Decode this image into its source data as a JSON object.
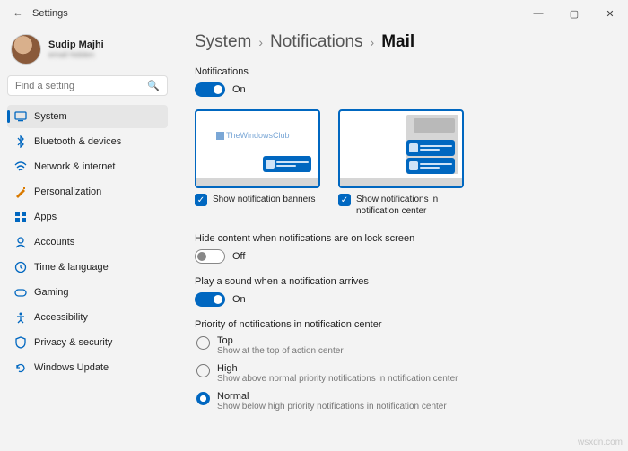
{
  "titlebar": {
    "title": "Settings"
  },
  "user": {
    "name": "Sudip Majhi",
    "email": "email hidden"
  },
  "search": {
    "placeholder": "Find a setting"
  },
  "sidebar": {
    "items": [
      {
        "label": "System",
        "active": true
      },
      {
        "label": "Bluetooth & devices"
      },
      {
        "label": "Network & internet"
      },
      {
        "label": "Personalization"
      },
      {
        "label": "Apps"
      },
      {
        "label": "Accounts"
      },
      {
        "label": "Time & language"
      },
      {
        "label": "Gaming"
      },
      {
        "label": "Accessibility"
      },
      {
        "label": "Privacy & security"
      },
      {
        "label": "Windows Update"
      }
    ]
  },
  "breadcrumb": {
    "a": "System",
    "b": "Notifications",
    "c": "Mail"
  },
  "notifications": {
    "label": "Notifications",
    "state": "On"
  },
  "watermark": "TheWindowsClub",
  "banners": {
    "label": "Show notification banners"
  },
  "center": {
    "label": "Show notifications in notification center"
  },
  "lock": {
    "label": "Hide content when notifications are on lock screen",
    "state": "Off"
  },
  "sound": {
    "label": "Play a sound when a notification arrives",
    "state": "On"
  },
  "priority": {
    "label": "Priority of notifications in notification center",
    "top": {
      "label": "Top",
      "desc": "Show at the top of action center"
    },
    "high": {
      "label": "High",
      "desc": "Show above normal priority notifications in notification center"
    },
    "normal": {
      "label": "Normal",
      "desc": "Show below high priority notifications in notification center"
    }
  },
  "source": "wsxdn.com"
}
